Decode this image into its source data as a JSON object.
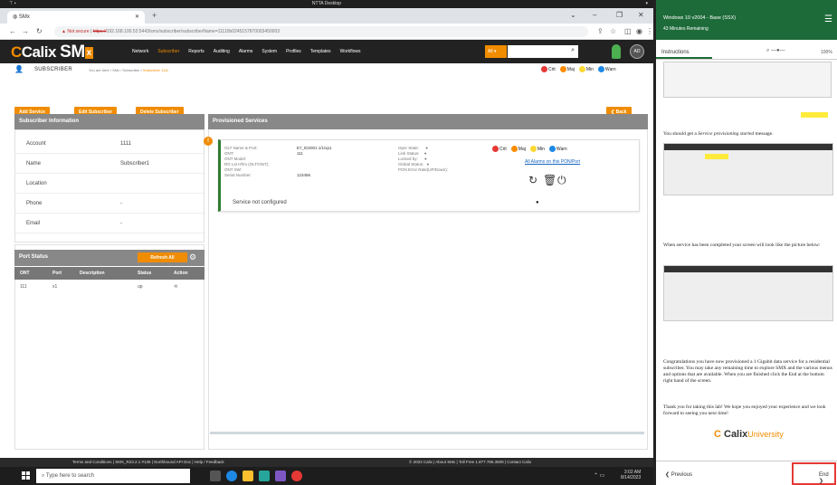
{
  "remote_desktop": {
    "title": "NTTA Desktop"
  },
  "browser": {
    "tab_title": "SMx",
    "address": {
      "warning": "Not secure",
      "scheme": "https://",
      "rest": "192.168.100.52:5443/smx/subscriber/subscriberName=11110b0245157870003450003"
    }
  },
  "app": {
    "logo_prefix": "Calix",
    "logo_main": "SM",
    "logo_x": "x",
    "nav": [
      "Network",
      "Subscriber",
      "Reports",
      "Auditing",
      "Alarms",
      "System",
      "Profiles",
      "Templates",
      "Workflows"
    ],
    "nav_active": "Subscriber",
    "all_label": "All",
    "avatar_initials": "AD"
  },
  "breadcrumb": {
    "section": "SUBSCRIBER",
    "path": "You are here / SMx / Subscriber / ",
    "current": "Subscriber 1111"
  },
  "legend": [
    {
      "label": "Crit",
      "color": "#e53935"
    },
    {
      "label": "Maj",
      "color": "#fb8c00"
    },
    {
      "label": "Min",
      "color": "#fdd835"
    },
    {
      "label": "Warn",
      "color": "#1e88e5"
    }
  ],
  "actions": {
    "add": "Add Service",
    "edit": "Edit Subscriber",
    "delete": "Delete Subscriber",
    "back": "Back"
  },
  "subscriber_info": {
    "title": "Subscriber Information",
    "rows": [
      {
        "k": "Account",
        "v": "1111"
      },
      {
        "k": "Name",
        "v": "Subscriber1"
      },
      {
        "k": "Location",
        "v": ""
      },
      {
        "k": "Phone",
        "v": "-"
      },
      {
        "k": "Email",
        "v": "-"
      }
    ]
  },
  "port_status": {
    "title": "Port Status",
    "refresh": "Refresh All",
    "cols": [
      "ONT",
      "Port",
      "Description",
      "Status",
      "Action"
    ],
    "row": [
      "111",
      "x1",
      "",
      "up",
      ""
    ]
  },
  "provisioned": {
    "title": "Provisioned Services",
    "left_labels": [
      "OLT Name & Port:",
      "ONT:",
      "ONT Model:",
      "RG Lst Hfrm (OLT/ONT):",
      "ONT SW:",
      "Serial Number:"
    ],
    "left_values": [
      "E7_ID2001 1/1/xp1",
      "111",
      "",
      "",
      "",
      "123456"
    ],
    "mid_labels": [
      "Oper State:",
      "Link Status:",
      "Locked by:",
      "Global Status:",
      "PON Error Rate(UP/Down):"
    ],
    "alarms_link": "All Alarms on this PON/Port",
    "status": "Service not configured"
  },
  "footer": {
    "left": "Terms and Conditions  |  SMX_R23.2.1 #135  |  Northbound API Doc  |  Help / Feedback",
    "right": "© 2023 Calix  |  About SMx  |  Toll Free 1.877.766.3509  |  Contact Calix"
  },
  "taskbar": {
    "search": "Type here to search",
    "time": "3:02 AM",
    "date": "8/14/2023"
  },
  "side": {
    "header_line1": "Windows 10 v2004 - Base (SSX)",
    "header_line2": "43 Minutes Remaining",
    "tab": "Instructions",
    "zoom": "100%",
    "text1_pre": "You should get a ",
    "text1_em": "Service provisioning started",
    "text1_post": " message.",
    "text2": "When service has been completed your screen will look like the picture below:",
    "text3": "Congratulations you have now provisioned a 1 Gigabit data service for a residential subscriber. You may take any remaining time to explore SMX and the various menus and options that are available. When you are finished click the End at the bottom right hand of the screen.",
    "text4": "Thank you for taking this lab! We hope you enjoyed your experience and we look forward to seeing you next time!",
    "logo": "Calix",
    "logo_suffix": "University",
    "prev": "Previous",
    "end": "End"
  }
}
